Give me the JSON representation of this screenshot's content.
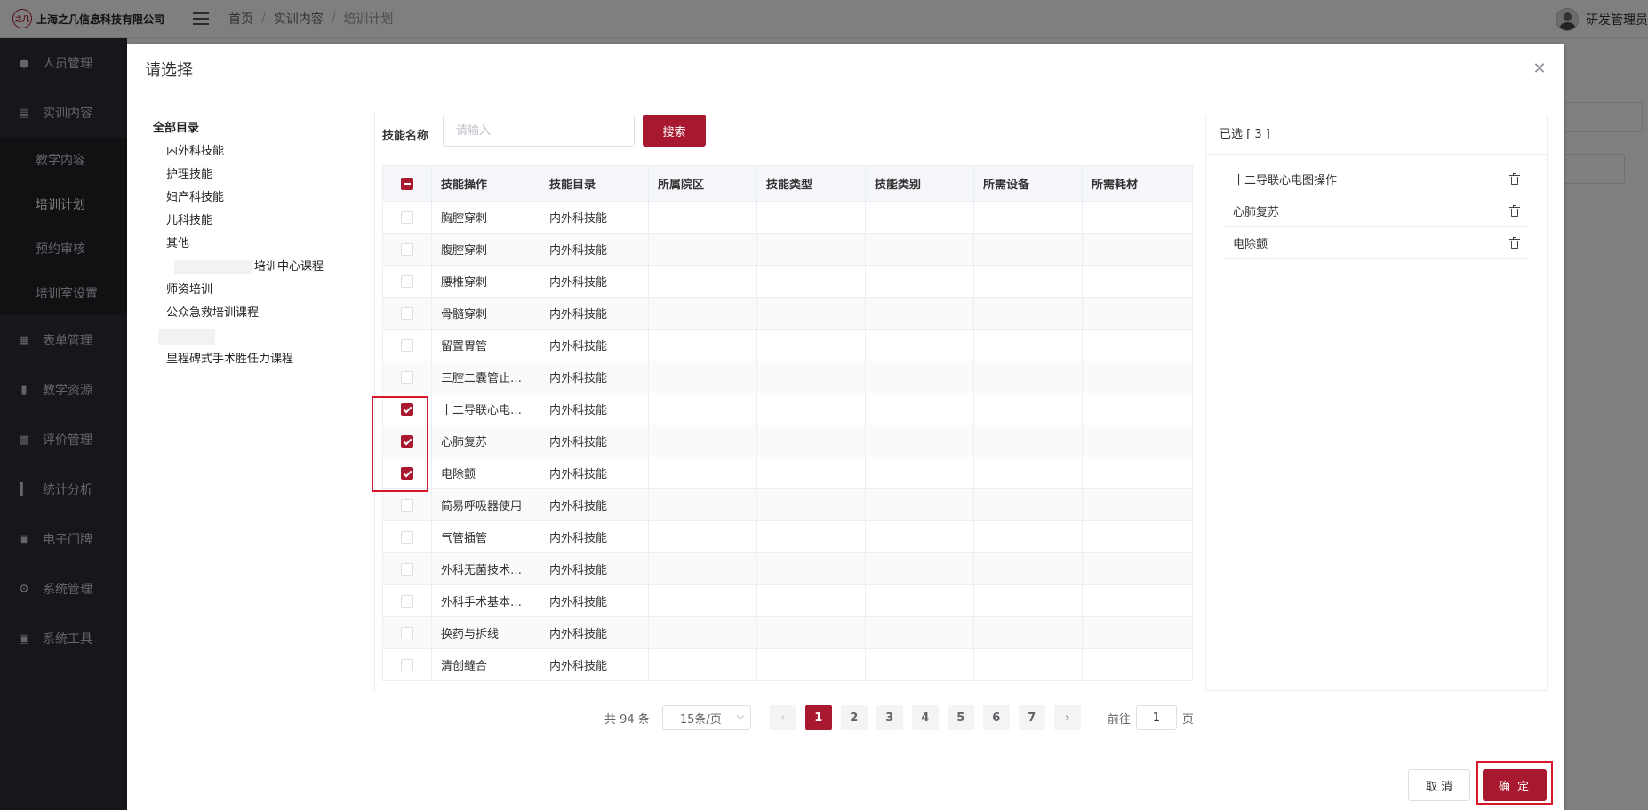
{
  "header": {
    "company": "上海之几信息科技有限公司",
    "logo_text": "之几",
    "breadcrumb": [
      "首页",
      "实训内容",
      "培训计划"
    ],
    "user_name": "研发管理员"
  },
  "sidebar": {
    "items": [
      {
        "label": "人员管理",
        "icon": "person-icon"
      },
      {
        "label": "实训内容",
        "icon": "book-icon"
      },
      {
        "label": "表单管理",
        "icon": "form-icon"
      },
      {
        "label": "教学资源",
        "icon": "resource-icon"
      },
      {
        "label": "评价管理",
        "icon": "evaluation-icon"
      },
      {
        "label": "统计分析",
        "icon": "chart-icon"
      },
      {
        "label": "电子门牌",
        "icon": "monitor-icon"
      },
      {
        "label": "系统管理",
        "icon": "gear-icon"
      },
      {
        "label": "系统工具",
        "icon": "toolbox-icon"
      }
    ],
    "subitems": [
      "教学内容",
      "培训计划",
      "预约审核",
      "培训室设置"
    ]
  },
  "dialog": {
    "title": "请选择",
    "close_icon": "close-icon",
    "cancel_label": "取 消",
    "ok_label": "确 定"
  },
  "tree": {
    "root": "全部目录",
    "nodes": [
      "内外科技能",
      "护理技能",
      "妇产科技能",
      "儿科技能",
      "其他",
      "培训中心课程",
      "师资培训",
      "公众急救培训课程",
      "",
      "里程碑式手术胜任力课程"
    ]
  },
  "search": {
    "label": "技能名称",
    "placeholder": "请输入",
    "value": "",
    "button": "搜索"
  },
  "table": {
    "headers": [
      "技能操作",
      "技能目录",
      "所属院区",
      "技能类型",
      "技能类别",
      "所需设备",
      "所需耗材"
    ],
    "rows": [
      {
        "name": "胸腔穿刺",
        "catalog": "内外科技能",
        "checked": false
      },
      {
        "name": "腹腔穿刺",
        "catalog": "内外科技能",
        "checked": false
      },
      {
        "name": "腰椎穿刺",
        "catalog": "内外科技能",
        "checked": false
      },
      {
        "name": "骨髓穿刺",
        "catalog": "内外科技能",
        "checked": false
      },
      {
        "name": "留置胃管",
        "catalog": "内外科技能",
        "checked": false
      },
      {
        "name": "三腔二囊管止…",
        "catalog": "内外科技能",
        "checked": false
      },
      {
        "name": "十二导联心电…",
        "catalog": "内外科技能",
        "checked": true
      },
      {
        "name": "心肺复苏",
        "catalog": "内外科技能",
        "checked": true
      },
      {
        "name": "电除颤",
        "catalog": "内外科技能",
        "checked": true
      },
      {
        "name": "简易呼吸器使用",
        "catalog": "内外科技能",
        "checked": false
      },
      {
        "name": "气管插管",
        "catalog": "内外科技能",
        "checked": false
      },
      {
        "name": "外科无菌技术…",
        "catalog": "内外科技能",
        "checked": false
      },
      {
        "name": "外科手术基本…",
        "catalog": "内外科技能",
        "checked": false
      },
      {
        "name": "换药与拆线",
        "catalog": "内外科技能",
        "checked": false
      },
      {
        "name": "清创缝合",
        "catalog": "内外科技能",
        "checked": false
      }
    ]
  },
  "pagination": {
    "total": "共 94 条",
    "page_size": "15条/页",
    "pages": [
      "1",
      "2",
      "3",
      "4",
      "5",
      "6",
      "7"
    ],
    "current": "1",
    "goto_label": "前往",
    "goto_value": "1",
    "page_unit": "页",
    "prev_icon": "chevron-left-icon",
    "next_icon": "chevron-right-icon"
  },
  "selected": {
    "title": "已选 [ 3 ]",
    "items": [
      "十二导联心电图操作",
      "心肺复苏",
      "电除颤"
    ]
  },
  "colors": {
    "accent": "#a8182e",
    "sidebar_bg": "#2a2e35",
    "highlight": "#d9172b"
  }
}
